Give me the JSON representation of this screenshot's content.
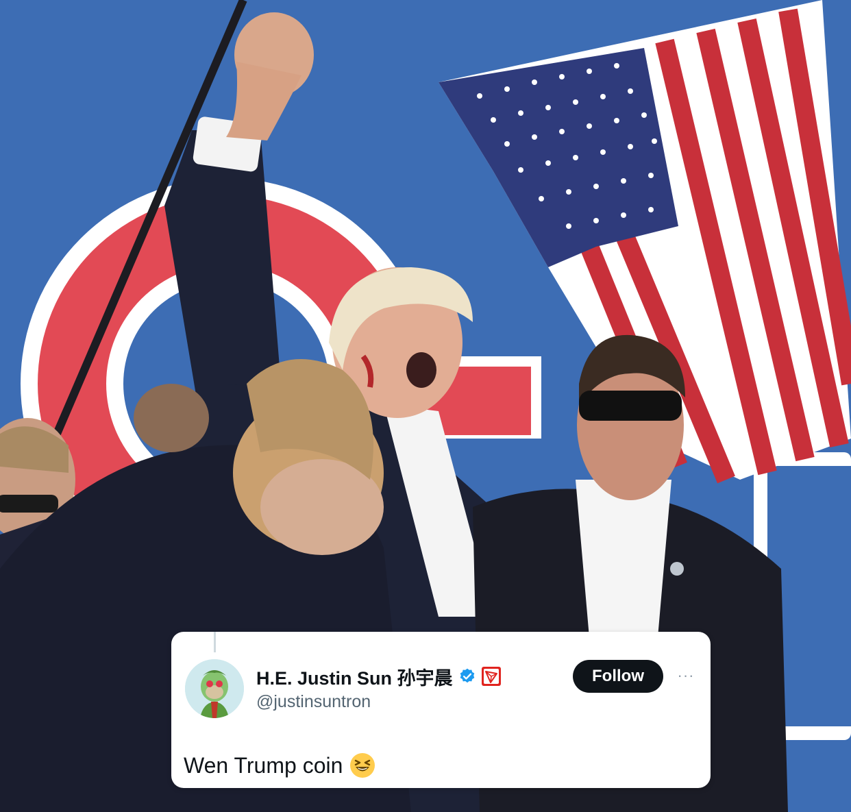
{
  "tweet": {
    "display_name": "H.E. Justin Sun 孙宇晨",
    "handle": "@justinsuntron",
    "follow_label": "Follow",
    "more_label": "···",
    "text": "Wen Trump coin",
    "verified_icon": "verified-badge-icon",
    "affiliate_icon": "tron-logo-icon",
    "emoji": "grinning-squinting-face",
    "colors": {
      "verified": "#1d9bf0",
      "affiliate": "#e0241f",
      "follow_bg": "#0f1419",
      "handle": "#536471"
    }
  },
  "photo": {
    "subject": "rally-photo-raised-fist",
    "flag": "us-flag"
  }
}
